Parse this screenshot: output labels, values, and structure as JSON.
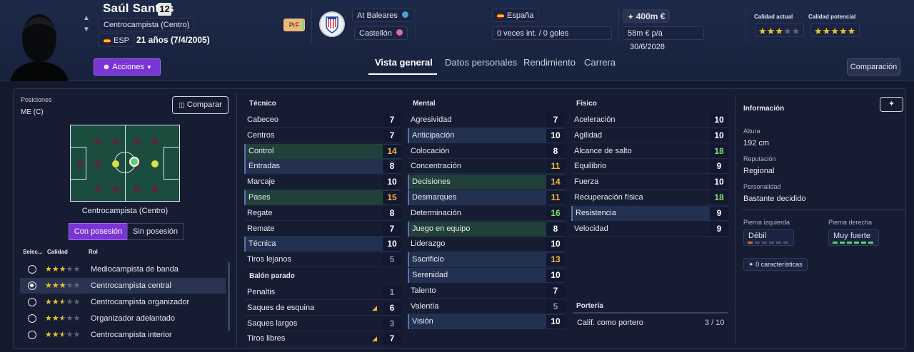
{
  "player": {
    "name": "Saúl Santos",
    "number": "12",
    "position": "Centrocampista (Centro)",
    "nationality_code": "ESP",
    "age": "21 años (7/4/2005)",
    "personality_tag": "PrF"
  },
  "club": {
    "region": "At Baleares",
    "city": "Castellón"
  },
  "country": {
    "name": "España",
    "caps": "0 veces int. / 0 goles"
  },
  "contract": {
    "value": "400m €",
    "wage": "58m € p/a",
    "expires": "30/6/2028"
  },
  "ability": {
    "current_label": "Calidad actual",
    "current_stars": 3,
    "potential_label": "Calidad potencial",
    "potential_stars": 5
  },
  "actions_label": "Acciones",
  "tabs": [
    "Vista general",
    "Datos personales",
    "Rendimiento",
    "Carrera"
  ],
  "compare_label": "Comparación",
  "left": {
    "positions_label": "Posiciones",
    "positions_value": "ME (C)",
    "compare_button": "Comparar",
    "pitch_caption": "Centrocampista (Centro)",
    "seg_on": "Con posesión",
    "seg_off": "Sin posesión",
    "hdr_select": "Selec...",
    "hdr_quality": "Calidad",
    "hdr_role": "Rol",
    "roles": [
      {
        "name": "Mediocampista de banda",
        "stars": 3,
        "selected": false
      },
      {
        "name": "Centrocampista central",
        "stars": 3,
        "selected": true
      },
      {
        "name": "Centrocampista organizador",
        "stars": 2.5,
        "selected": false
      },
      {
        "name": "Organizador adelantado",
        "stars": 2.5,
        "selected": false
      },
      {
        "name": "Centrocampista interior",
        "stars": 2.5,
        "selected": false
      }
    ]
  },
  "technical": {
    "title": "Técnico",
    "items": [
      {
        "name": "Cabeceo",
        "value": "7",
        "hl": "",
        "color": "#ffffff"
      },
      {
        "name": "Centros",
        "value": "7",
        "hl": "",
        "color": "#ffffff"
      },
      {
        "name": "Control",
        "value": "14",
        "hl": "green",
        "color": "#f5b731"
      },
      {
        "name": "Entradas",
        "value": "8",
        "hl": "blue",
        "color": "#ffffff"
      },
      {
        "name": "Marcaje",
        "value": "10",
        "hl": "",
        "color": "#ffffff"
      },
      {
        "name": "Pases",
        "value": "15",
        "hl": "green",
        "color": "#f5b731"
      },
      {
        "name": "Regate",
        "value": "8",
        "hl": "",
        "color": "#ffffff"
      },
      {
        "name": "Remate",
        "value": "7",
        "hl": "",
        "color": "#ffffff"
      },
      {
        "name": "Técnica",
        "value": "10",
        "hl": "blue",
        "color": "#ffffff"
      },
      {
        "name": "Tiros lejanos",
        "value": "5",
        "hl": "",
        "color": "#8a93aa"
      }
    ]
  },
  "set_pieces": {
    "title": "Balón parado",
    "items": [
      {
        "name": "Penaltis",
        "value": "1",
        "color": "#8a93aa",
        "arrow": false
      },
      {
        "name": "Saques de esquina",
        "value": "6",
        "color": "#ffffff",
        "arrow": true
      },
      {
        "name": "Saques largos",
        "value": "3",
        "color": "#8a93aa",
        "arrow": false
      },
      {
        "name": "Tiros libres",
        "value": "7",
        "color": "#ffffff",
        "arrow": true
      }
    ]
  },
  "mental": {
    "title": "Mental",
    "items": [
      {
        "name": "Agresividad",
        "value": "7",
        "hl": "",
        "color": "#ffffff"
      },
      {
        "name": "Anticipación",
        "value": "10",
        "hl": "blue",
        "color": "#ffffff"
      },
      {
        "name": "Colocación",
        "value": "8",
        "hl": "",
        "color": "#ffffff"
      },
      {
        "name": "Concentración",
        "value": "11",
        "hl": "",
        "color": "#f5b731"
      },
      {
        "name": "Decisiones",
        "value": "14",
        "hl": "green",
        "color": "#f5b731"
      },
      {
        "name": "Desmarques",
        "value": "11",
        "hl": "blue",
        "color": "#f5b731"
      },
      {
        "name": "Determinación",
        "value": "16",
        "hl": "",
        "color": "#7fe06a"
      },
      {
        "name": "Juego en equipo",
        "value": "8",
        "hl": "green",
        "color": "#ffffff"
      },
      {
        "name": "Liderazgo",
        "value": "10",
        "hl": "",
        "color": "#ffffff"
      },
      {
        "name": "Sacrificio",
        "value": "13",
        "hl": "blue",
        "color": "#f5b731"
      },
      {
        "name": "Serenidad",
        "value": "10",
        "hl": "blue",
        "color": "#ffffff"
      },
      {
        "name": "Talento",
        "value": "7",
        "hl": "",
        "color": "#ffffff"
      },
      {
        "name": "Valentía",
        "value": "5",
        "hl": "",
        "color": "#8a93aa"
      },
      {
        "name": "Visión",
        "value": "10",
        "hl": "blue",
        "color": "#ffffff"
      }
    ]
  },
  "physical": {
    "title": "Físico",
    "items": [
      {
        "name": "Aceleración",
        "value": "10",
        "hl": "",
        "color": "#ffffff"
      },
      {
        "name": "Agilidad",
        "value": "10",
        "hl": "",
        "color": "#ffffff"
      },
      {
        "name": "Alcance de salto",
        "value": "18",
        "hl": "",
        "color": "#7fe06a"
      },
      {
        "name": "Equilibrio",
        "value": "9",
        "hl": "",
        "color": "#ffffff"
      },
      {
        "name": "Fuerza",
        "value": "10",
        "hl": "",
        "color": "#ffffff"
      },
      {
        "name": "Recuperación física",
        "value": "18",
        "hl": "",
        "color": "#7fe06a"
      },
      {
        "name": "Resistencia",
        "value": "9",
        "hl": "blue",
        "color": "#ffffff"
      },
      {
        "name": "Velocidad",
        "value": "9",
        "hl": "",
        "color": "#ffffff"
      }
    ]
  },
  "goalkeeping": {
    "title": "Portería",
    "label": "Calif. como portero",
    "value": "3 / 10"
  },
  "info": {
    "title": "Información",
    "height_label": "Altura",
    "height": "192 cm",
    "reputation_label": "Reputación",
    "reputation": "Regional",
    "personality_label": "Personalidad",
    "personality": "Bastante decidido",
    "left_foot_label": "Pierna izquierda",
    "left_foot": "Débil",
    "left_foot_level": 1,
    "right_foot_label": "Pierna derecha",
    "right_foot": "Muy fuerte",
    "right_foot_level": 6,
    "traits": "0 características"
  }
}
